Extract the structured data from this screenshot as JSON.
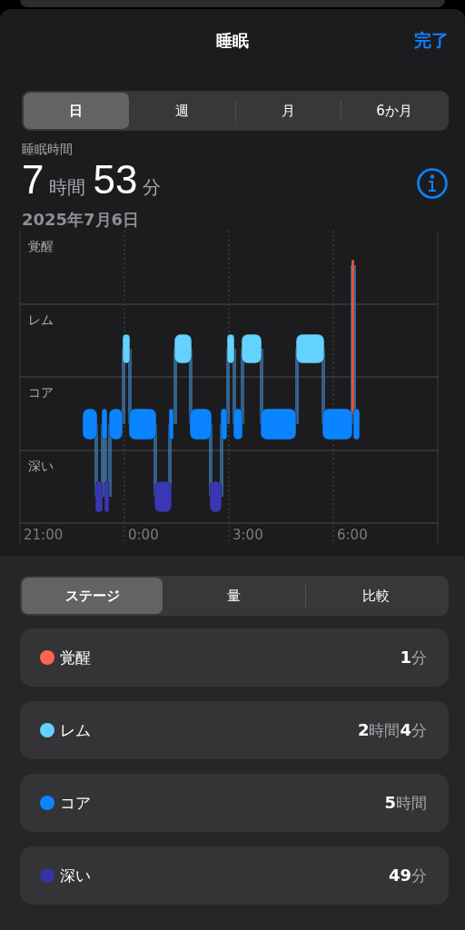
{
  "header": {
    "title": "睡眠",
    "done": "完了"
  },
  "range_tabs": [
    {
      "label": "日",
      "selected": true
    },
    {
      "label": "週",
      "selected": false
    },
    {
      "label": "月",
      "selected": false
    },
    {
      "label": "6か月",
      "selected": false
    }
  ],
  "summary": {
    "label": "睡眠時間",
    "duration": "**7**時間**53**分",
    "date": "2025年7月6日"
  },
  "chart": {
    "y_labels": [
      "覚醒",
      "レム",
      "コア",
      "深い"
    ],
    "x_labels": [
      "21:00",
      "0:00",
      "3:00",
      "6:00"
    ]
  },
  "view_tabs": [
    {
      "label": "ステージ",
      "selected": true
    },
    {
      "label": "量",
      "selected": false
    },
    {
      "label": "比較",
      "selected": false
    }
  ],
  "stages": [
    {
      "name": "覚醒",
      "value": "**1**分",
      "color": "#ff6550"
    },
    {
      "name": "レム",
      "value": "**2**時間**4**分",
      "color": "#64d2ff"
    },
    {
      "name": "コア",
      "value": "**5**時間",
      "color": "#0a84ff"
    },
    {
      "name": "深い",
      "value": "**49**分",
      "color": "#3634a3"
    }
  ]
}
